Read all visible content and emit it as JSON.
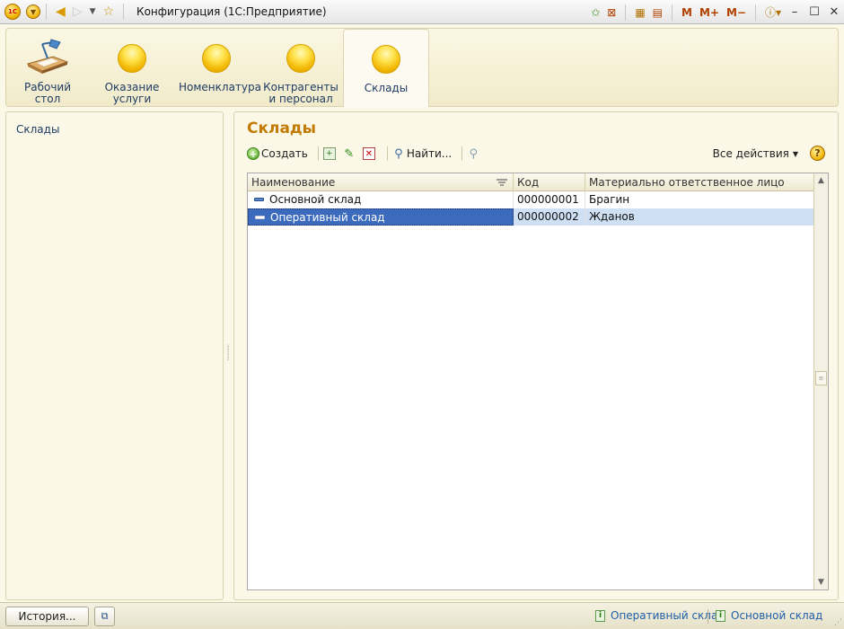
{
  "window": {
    "title": "Конфигурация  (1С:Предприятие)",
    "logo_text": "1С",
    "m_buttons": [
      "M",
      "M+",
      "M−"
    ]
  },
  "sections": [
    {
      "label": "Рабочий стол",
      "icon": "desk-lamp-icon"
    },
    {
      "label": "Оказание услуги",
      "icon": "yellow-ball-icon"
    },
    {
      "label": "Номенклатура",
      "icon": "yellow-ball-icon"
    },
    {
      "label": "Контрагенты и персонал",
      "icon": "yellow-ball-icon"
    },
    {
      "label": "Склады",
      "icon": "yellow-ball-icon",
      "active": true
    }
  ],
  "left_panel": {
    "items": [
      {
        "label": "Склады"
      }
    ]
  },
  "main": {
    "title": "Склады",
    "toolbar": {
      "create_label": "Создать",
      "find_label": "Найти...",
      "all_actions_label": "Все действия",
      "help_label": "?"
    },
    "table": {
      "columns": [
        "Наименование",
        "Код",
        "Материально ответственное лицо"
      ],
      "rows": [
        {
          "name": "Основной склад",
          "code": "000000001",
          "person": "Брагин"
        },
        {
          "name": "Оперативный склад",
          "code": "000000002",
          "person": "Жданов",
          "selected": true
        }
      ]
    }
  },
  "statusbar": {
    "history_label": "История...",
    "open_windows": [
      "Оперативный склад",
      "Основной склад"
    ]
  },
  "colors": {
    "accent_title": "#c27a00",
    "link": "#1f3b63",
    "selection": "#3c6bbd",
    "row_highlight": "#cfe0f5"
  }
}
